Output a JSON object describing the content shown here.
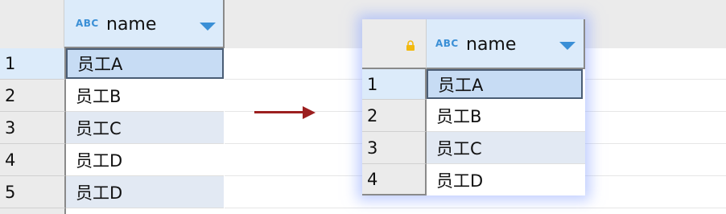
{
  "source_grid": {
    "column_header": {
      "type_badge": "ABC",
      "label": "name",
      "menu_icon": "chevron-down-icon"
    },
    "rows": [
      {
        "index": "1",
        "value": "员工A"
      },
      {
        "index": "2",
        "value": "员工B"
      },
      {
        "index": "3",
        "value": "员工C"
      },
      {
        "index": "4",
        "value": "员工D"
      },
      {
        "index": "5",
        "value": "员工D"
      }
    ]
  },
  "transition": {
    "icon": "arrow-right-icon",
    "color": "#9c1f1f"
  },
  "result_grid": {
    "corner_icon": "lock-icon",
    "column_header": {
      "type_badge": "ABC",
      "label": "name",
      "menu_icon": "chevron-down-icon"
    },
    "rows": [
      {
        "index": "1",
        "value": "员工A"
      },
      {
        "index": "2",
        "value": "员工B"
      },
      {
        "index": "3",
        "value": "员工C"
      },
      {
        "index": "4",
        "value": "员工D"
      }
    ]
  },
  "colors": {
    "header_bg": "#ebebeb",
    "column_header_bg": "#dcebfa",
    "selected_cell_bg": "#c7dcf4",
    "alt_row_bg": "#e2e9f3",
    "accent_blue": "#3a8fd6",
    "lock_yellow": "#f2b90f"
  }
}
